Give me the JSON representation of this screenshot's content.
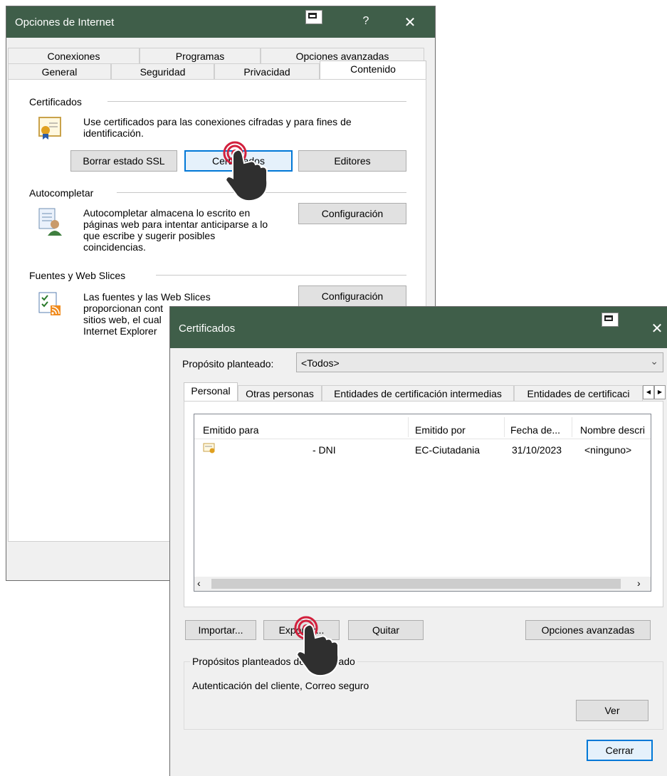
{
  "internet_options": {
    "title": "Opciones de Internet",
    "help_glyph": "?",
    "close_glyph": "✕",
    "tabs_row1": [
      "Conexiones",
      "Programas",
      "Opciones avanzadas"
    ],
    "tabs_row2": [
      "General",
      "Seguridad",
      "Privacidad",
      "Contenido"
    ],
    "certificates": {
      "group": "Certificados",
      "desc": "Use certificados para las conexiones cifradas y para fines de identificación.",
      "clear_ssl": "Borrar estado SSL",
      "certificates_btn": "Certificados",
      "publishers": "Editores"
    },
    "autocomplete": {
      "group": "Autocompletar",
      "desc": "Autocompletar almacena lo escrito en páginas web para intentar anticiparse a lo que escribe y sugerir posibles coincidencias.",
      "settings": "Configuración"
    },
    "feeds": {
      "group": "Fuentes y Web Slices",
      "desc_l1": "Las fuentes y las Web Slices",
      "desc_l2": "proporcionan cont",
      "desc_l3": "sitios web, el cual",
      "desc_l4": "Internet Explorer",
      "settings": "Configuración"
    }
  },
  "certificates_dialog": {
    "title": "Certificados",
    "close_glyph": "✕",
    "purpose_label": "Propósito planteado:",
    "purpose_value": "<Todos>",
    "tabs": [
      "Personal",
      "Otras personas",
      "Entidades de certificación intermedias",
      "Entidades de certificaci"
    ],
    "columns": [
      "Emitido para",
      "Emitido por",
      "Fecha de...",
      "Nombre descri"
    ],
    "rows": [
      {
        "issued_to": "- DNI",
        "issued_by": "EC-Ciutadania",
        "date": "31/10/2023",
        "friendly": "<ninguno>"
      }
    ],
    "import": "Importar...",
    "export": "Exportar...",
    "remove": "Quitar",
    "advanced": "Opciones avanzadas",
    "purposes_group": "Propósitos planteados del certificado",
    "purposes_value": "Autenticación del cliente, Correo seguro",
    "view": "Ver",
    "close": "Cerrar"
  },
  "colors": {
    "titlebar": "#3f5e49",
    "focus": "#0078d7",
    "click_marker": "#d21f3c"
  }
}
